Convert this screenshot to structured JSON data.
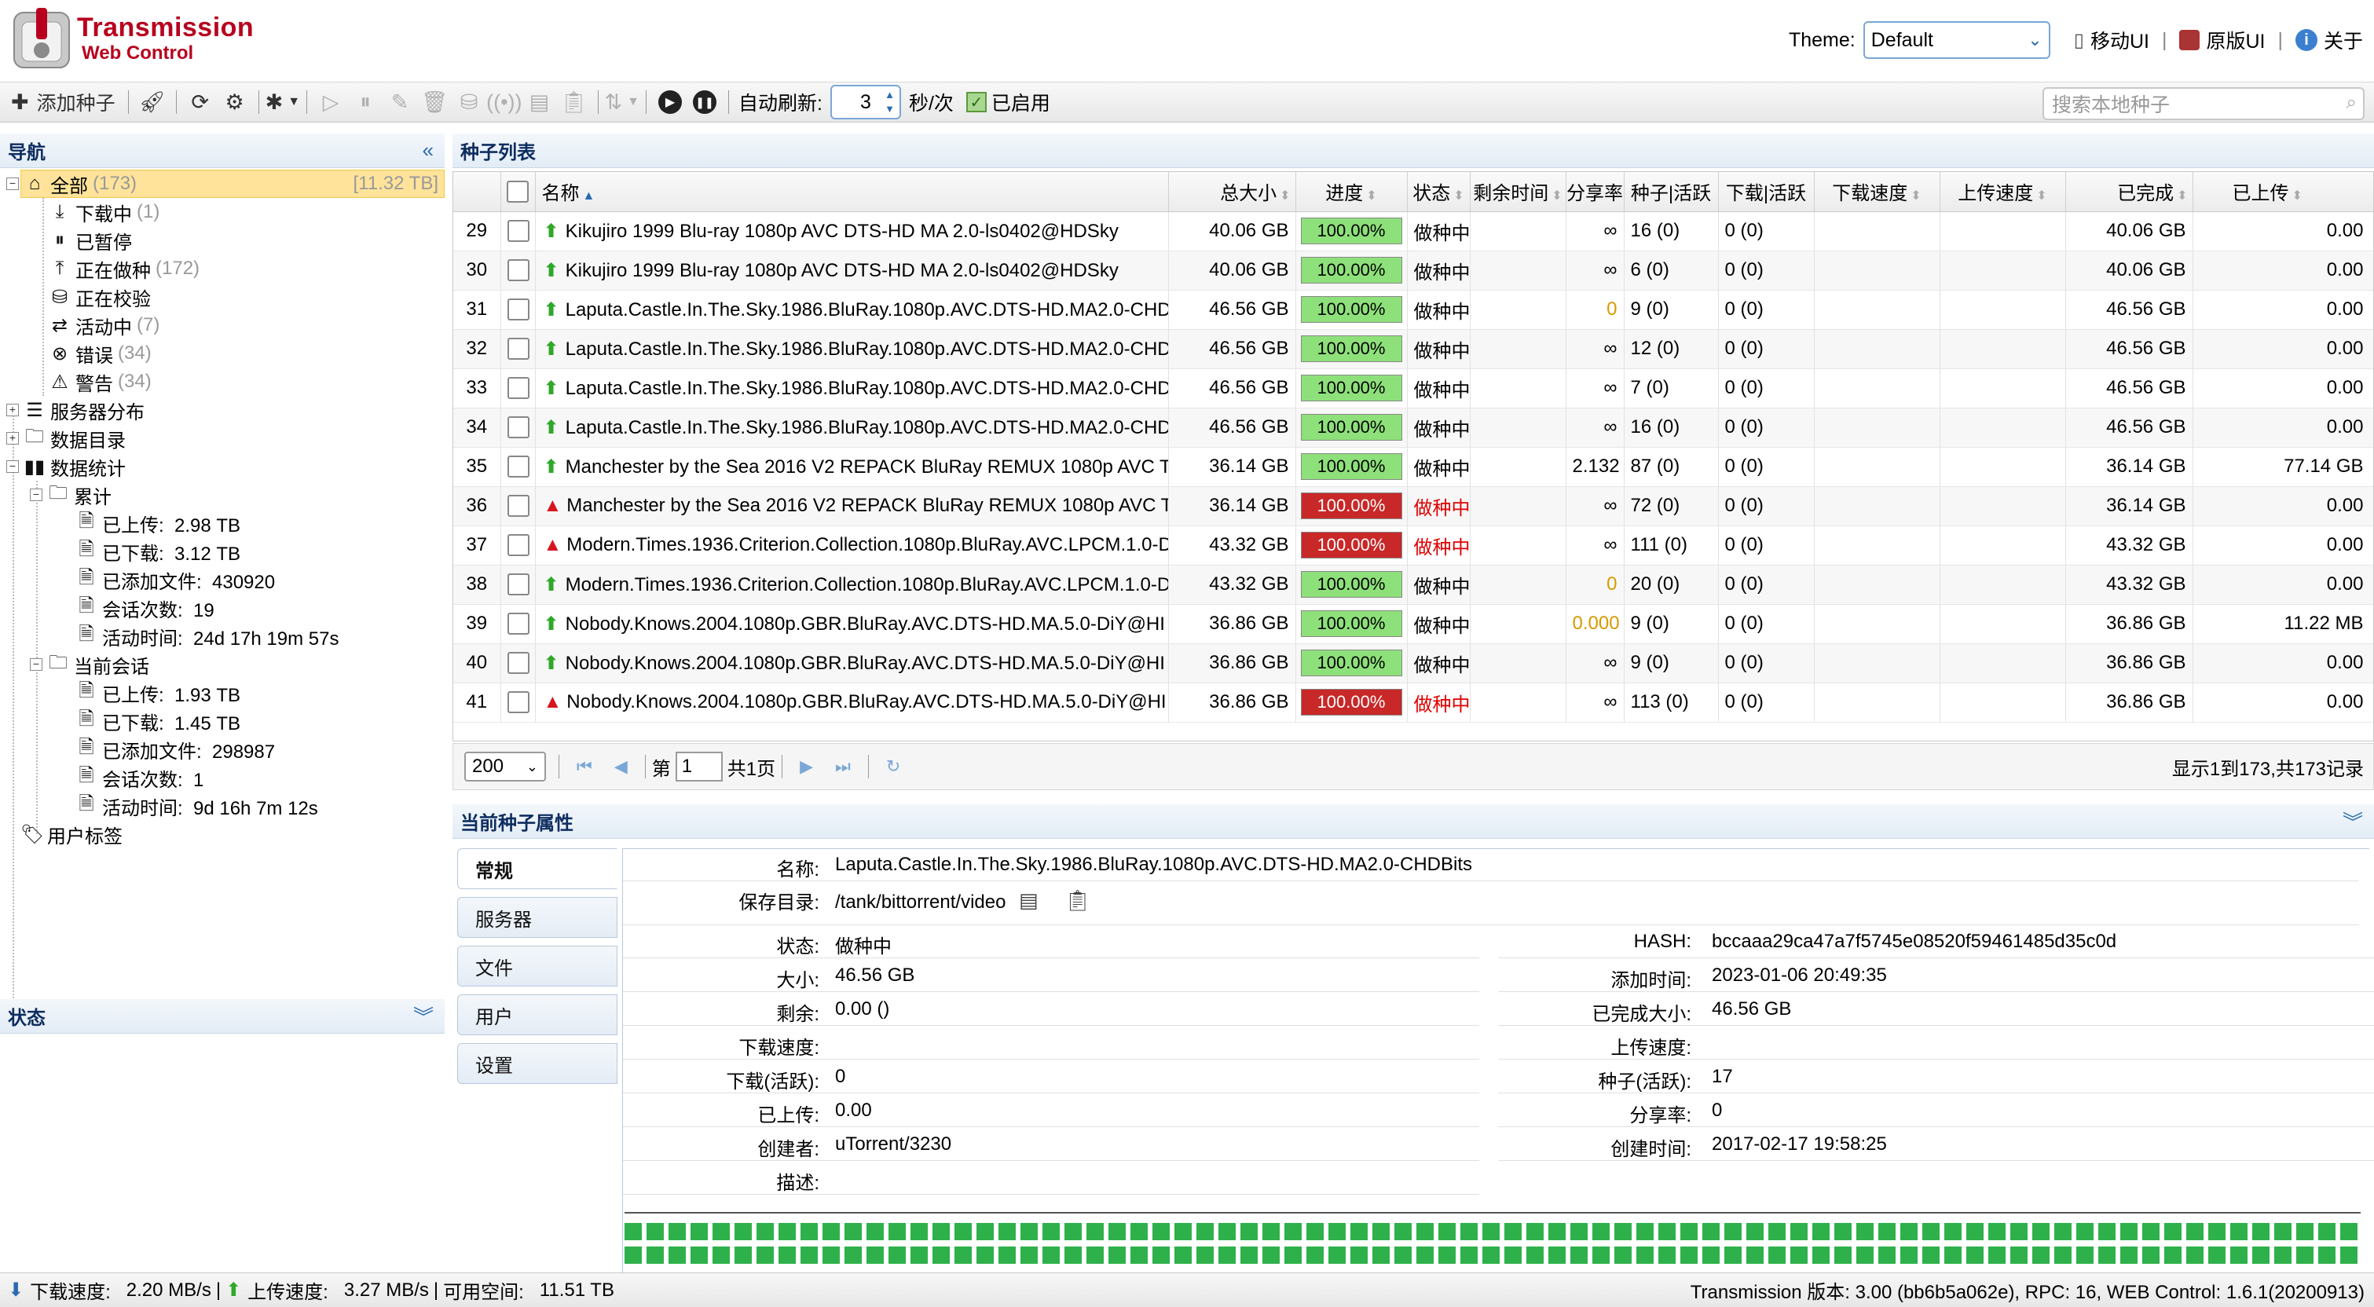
{
  "header": {
    "brand_line1": "Transmission",
    "brand_line2": "Web Control",
    "theme_label": "Theme:",
    "theme_value": "Default",
    "mobile_ui": "移动UI",
    "original_ui": "原版UI",
    "about": "关于"
  },
  "toolbar": {
    "add_torrent": "添加种子",
    "auto_refresh_label": "自动刷新:",
    "auto_refresh_value": "3",
    "unit": "秒/次",
    "enabled": "已启用",
    "search_placeholder": "搜索本地种子"
  },
  "nav": {
    "title": "导航",
    "all": {
      "label": "全部",
      "count": "(173)",
      "size": "[11.32 TB]"
    },
    "items": [
      {
        "label": "下载中",
        "count": "(1)"
      },
      {
        "label": "已暂停",
        "count": ""
      },
      {
        "label": "正在做种",
        "count": "(172)"
      },
      {
        "label": "正在校验",
        "count": ""
      },
      {
        "label": "活动中",
        "count": "(7)"
      },
      {
        "label": "错误",
        "count": "(34)"
      },
      {
        "label": "警告",
        "count": "(34)"
      }
    ],
    "servers": "服务器分布",
    "folders": "数据目录",
    "stats": "数据统计",
    "cumulative": {
      "label": "累计",
      "uploaded": "已上传:  2.98 TB",
      "downloaded": "已下载:  3.12 TB",
      "files_added": "已添加文件:  430920",
      "sessions": "会话次数:  19",
      "active_time": "活动时间:  24d 17h 19m 57s"
    },
    "session": {
      "label": "当前会话",
      "uploaded": "已上传:  1.93 TB",
      "downloaded": "已下载:  1.45 TB",
      "files_added": "已添加文件:  298987",
      "sessions": "会话次数:  1",
      "active_time": "活动时间:  9d 16h 7m 12s"
    },
    "user_labels": "用户标签",
    "state_title": "状态"
  },
  "list": {
    "title": "种子列表",
    "columns": [
      "名称",
      "总大小",
      "进度",
      "状态",
      "剩余时间",
      "分享率",
      "种子|活跃",
      "下载|活跃",
      "下载速度",
      "上传速度",
      "已完成",
      "已上传"
    ],
    "rows": [
      {
        "n": "29",
        "icon": "up",
        "name": "Kikujiro 1999 Blu-ray 1080p AVC DTS-HD MA 2.0-ls0402@HDSky",
        "size": "40.06 GB",
        "progress": "100.00%",
        "pst": "ok",
        "status": "做种中",
        "ratio": "∞",
        "ro": false,
        "seeds": "16 (0)",
        "peers": "0 (0)",
        "done": "40.06 GB",
        "upl": "0.00"
      },
      {
        "n": "30",
        "icon": "up",
        "name": "Kikujiro 1999 Blu-ray 1080p AVC DTS-HD MA 2.0-ls0402@HDSky",
        "size": "40.06 GB",
        "progress": "100.00%",
        "pst": "ok",
        "status": "做种中",
        "ratio": "∞",
        "ro": false,
        "seeds": "6 (0)",
        "peers": "0 (0)",
        "done": "40.06 GB",
        "upl": "0.00"
      },
      {
        "n": "31",
        "icon": "up",
        "name": "Laputa.Castle.In.The.Sky.1986.BluRay.1080p.AVC.DTS-HD.MA2.0-CHD",
        "size": "46.56 GB",
        "progress": "100.00%",
        "pst": "ok",
        "status": "做种中",
        "ratio": "0",
        "ro": true,
        "seeds": "9 (0)",
        "peers": "0 (0)",
        "done": "46.56 GB",
        "upl": "0.00"
      },
      {
        "n": "32",
        "icon": "up",
        "name": "Laputa.Castle.In.The.Sky.1986.BluRay.1080p.AVC.DTS-HD.MA2.0-CHD",
        "size": "46.56 GB",
        "progress": "100.00%",
        "pst": "ok",
        "status": "做种中",
        "ratio": "∞",
        "ro": false,
        "seeds": "12 (0)",
        "peers": "0 (0)",
        "done": "46.56 GB",
        "upl": "0.00"
      },
      {
        "n": "33",
        "icon": "up",
        "name": "Laputa.Castle.In.The.Sky.1986.BluRay.1080p.AVC.DTS-HD.MA2.0-CHD",
        "size": "46.56 GB",
        "progress": "100.00%",
        "pst": "ok",
        "status": "做种中",
        "ratio": "∞",
        "ro": false,
        "seeds": "7 (0)",
        "peers": "0 (0)",
        "done": "46.56 GB",
        "upl": "0.00"
      },
      {
        "n": "34",
        "icon": "up",
        "name": "Laputa.Castle.In.The.Sky.1986.BluRay.1080p.AVC.DTS-HD.MA2.0-CHD",
        "size": "46.56 GB",
        "progress": "100.00%",
        "pst": "ok",
        "status": "做种中",
        "ratio": "∞",
        "ro": false,
        "seeds": "16 (0)",
        "peers": "0 (0)",
        "done": "46.56 GB",
        "upl": "0.00"
      },
      {
        "n": "35",
        "icon": "up",
        "name": "Manchester by the Sea 2016 V2 REPACK BluRay REMUX 1080p AVC T",
        "size": "36.14 GB",
        "progress": "100.00%",
        "pst": "ok",
        "status": "做种中",
        "ratio": "2.132",
        "ro": false,
        "seeds": "87 (0)",
        "peers": "0 (0)",
        "done": "36.14 GB",
        "upl": "77.14 GB"
      },
      {
        "n": "36",
        "icon": "warn",
        "name": "Manchester by the Sea 2016 V2 REPACK BluRay REMUX 1080p AVC T",
        "size": "36.14 GB",
        "progress": "100.00%",
        "pst": "err",
        "status": "做种中",
        "ratio": "∞",
        "ro": false,
        "seeds": "72 (0)",
        "peers": "0 (0)",
        "done": "36.14 GB",
        "upl": "0.00"
      },
      {
        "n": "37",
        "icon": "warn",
        "name": "Modern.Times.1936.Criterion.Collection.1080p.BluRay.AVC.LPCM.1.0-D",
        "size": "43.32 GB",
        "progress": "100.00%",
        "pst": "err",
        "status": "做种中",
        "ratio": "∞",
        "ro": false,
        "seeds": "111 (0)",
        "peers": "0 (0)",
        "done": "43.32 GB",
        "upl": "0.00"
      },
      {
        "n": "38",
        "icon": "up",
        "name": "Modern.Times.1936.Criterion.Collection.1080p.BluRay.AVC.LPCM.1.0-D",
        "size": "43.32 GB",
        "progress": "100.00%",
        "pst": "ok",
        "status": "做种中",
        "ratio": "0",
        "ro": true,
        "seeds": "20 (0)",
        "peers": "0 (0)",
        "done": "43.32 GB",
        "upl": "0.00"
      },
      {
        "n": "39",
        "icon": "up",
        "name": "Nobody.Knows.2004.1080p.GBR.BluRay.AVC.DTS-HD.MA.5.0-DiY@HI",
        "size": "36.86 GB",
        "progress": "100.00%",
        "pst": "ok",
        "status": "做种中",
        "ratio": "0.000",
        "ro": true,
        "seeds": "9 (0)",
        "peers": "0 (0)",
        "done": "36.86 GB",
        "upl": "11.22 MB"
      },
      {
        "n": "40",
        "icon": "up",
        "name": "Nobody.Knows.2004.1080p.GBR.BluRay.AVC.DTS-HD.MA.5.0-DiY@HI",
        "size": "36.86 GB",
        "progress": "100.00%",
        "pst": "ok",
        "status": "做种中",
        "ratio": "∞",
        "ro": false,
        "seeds": "9 (0)",
        "peers": "0 (0)",
        "done": "36.86 GB",
        "upl": "0.00"
      },
      {
        "n": "41",
        "icon": "warn",
        "name": "Nobody.Knows.2004.1080p.GBR.BluRay.AVC.DTS-HD.MA.5.0-DiY@HI",
        "size": "36.86 GB",
        "progress": "100.00%",
        "pst": "err",
        "status": "做种中",
        "ratio": "∞",
        "ro": false,
        "seeds": "113 (0)",
        "peers": "0 (0)",
        "done": "36.86 GB",
        "upl": "0.00"
      }
    ],
    "pager": {
      "page_size": "200",
      "page_prefix": "第",
      "page_value": "1",
      "page_total": "共1页",
      "info": "显示1到173,共173记录"
    }
  },
  "props": {
    "title": "当前种子属性",
    "tabs": [
      "常规",
      "服务器",
      "文件",
      "用户",
      "设置"
    ],
    "name_label": "名称:",
    "name_value": "Laputa.Castle.In.The.Sky.1986.BluRay.1080p.AVC.DTS-HD.MA2.0-CHDBits",
    "dir_label": "保存目录:",
    "dir_value": "/tank/bittorrent/video",
    "left": [
      {
        "label": "状态:",
        "value": "做种中"
      },
      {
        "label": "大小:",
        "value": "46.56 GB"
      },
      {
        "label": "剩余:",
        "value": "0.00 ()"
      },
      {
        "label": "下载速度:",
        "value": ""
      },
      {
        "label": "下载(活跃):",
        "value": "0"
      },
      {
        "label": "已上传:",
        "value": "0.00"
      },
      {
        "label": "创建者:",
        "value": "uTorrent/3230"
      },
      {
        "label": "描述:",
        "value": ""
      }
    ],
    "right": [
      {
        "label": "HASH:",
        "value": "bccaaa29ca47a7f5745e08520f59461485d35c0d"
      },
      {
        "label": "添加时间:",
        "value": "2023-01-06 20:49:35"
      },
      {
        "label": "已完成大小:",
        "value": "46.56 GB"
      },
      {
        "label": "上传速度:",
        "value": ""
      },
      {
        "label": "种子(活跃):",
        "value": "17"
      },
      {
        "label": "分享率:",
        "value": "0"
      },
      {
        "label": "创建时间:",
        "value": "2017-02-17 19:58:25"
      }
    ]
  },
  "statusbar": {
    "dl_label": "下载速度:",
    "dl_value": "2.20 MB/s",
    "ul_label": "上传速度:",
    "ul_value": "3.27 MB/s",
    "free_label": "可用空间:",
    "free_value": "11.51 TB",
    "version": "Transmission 版本: 3.00 (bb6b5a062e), RPC: 16, WEB Control: 1.6.1(20200913)"
  },
  "colors": {
    "accent": "#2a6bb0",
    "ok": "#8ee07a",
    "error": "#c82828",
    "seed_piece": "#2eb14a"
  },
  "icons": [
    "plus-icon",
    "rocket-icon",
    "refresh-icon",
    "gear-icon",
    "plugin-icon",
    "play-icon",
    "pause-icon"
  ]
}
